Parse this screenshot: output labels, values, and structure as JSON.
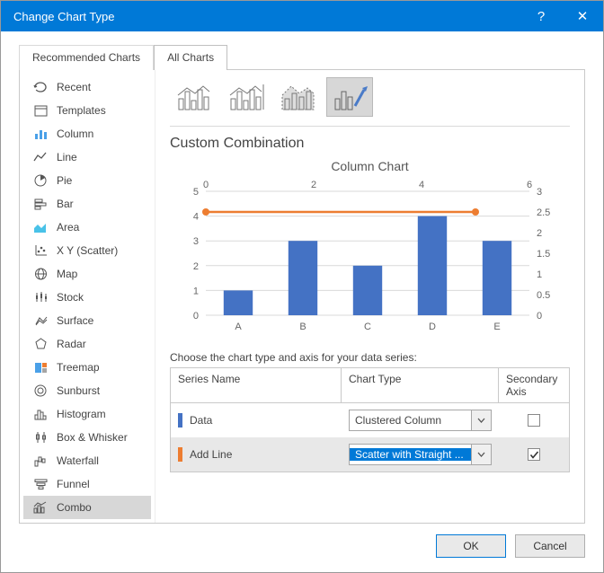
{
  "window": {
    "title": "Change Chart Type",
    "help_symbol": "?",
    "close_symbol": "✕"
  },
  "tabs": {
    "recommended": "Recommended Charts",
    "all": "All Charts"
  },
  "sidebar": {
    "items": [
      {
        "label": "Recent"
      },
      {
        "label": "Templates"
      },
      {
        "label": "Column"
      },
      {
        "label": "Line"
      },
      {
        "label": "Pie"
      },
      {
        "label": "Bar"
      },
      {
        "label": "Area"
      },
      {
        "label": "X Y (Scatter)"
      },
      {
        "label": "Map"
      },
      {
        "label": "Stock"
      },
      {
        "label": "Surface"
      },
      {
        "label": "Radar"
      },
      {
        "label": "Treemap"
      },
      {
        "label": "Sunburst"
      },
      {
        "label": "Histogram"
      },
      {
        "label": "Box & Whisker"
      },
      {
        "label": "Waterfall"
      },
      {
        "label": "Funnel"
      },
      {
        "label": "Combo"
      }
    ]
  },
  "main": {
    "section_title": "Custom Combination",
    "chart_title": "Column Chart",
    "series_instruction": "Choose the chart type and axis for your data series:",
    "table": {
      "headers": {
        "name": "Series Name",
        "type": "Chart Type",
        "axis": "Secondary Axis"
      },
      "rows": [
        {
          "swatch": "#4472c4",
          "name": "Data",
          "type": "Clustered Column",
          "secondary": false
        },
        {
          "swatch": "#ed7d31",
          "name": "Add Line",
          "type": "Scatter with Straight ...",
          "secondary": true
        }
      ]
    }
  },
  "footer": {
    "ok": "OK",
    "cancel": "Cancel"
  },
  "chart_data": {
    "type": "combo",
    "title": "Column Chart",
    "categories": [
      "A",
      "B",
      "C",
      "D",
      "E"
    ],
    "primary_axis": {
      "ylim": [
        0,
        5
      ],
      "ticks": [
        0,
        1,
        2,
        3,
        4,
        5
      ]
    },
    "secondary_axis": {
      "ylim": [
        0,
        3
      ],
      "ticks": [
        0,
        0.5,
        1,
        1.5,
        2,
        2.5,
        3
      ]
    },
    "top_axis": {
      "ticks": [
        0,
        2,
        4,
        6
      ]
    },
    "series": [
      {
        "name": "Data",
        "type": "bar",
        "axis": "primary",
        "color": "#4472c4",
        "values": [
          1,
          3,
          2,
          4,
          3
        ]
      },
      {
        "name": "Add Line",
        "type": "line",
        "axis": "secondary",
        "color": "#ed7d31",
        "y_value": 2.5,
        "x_range": [
          0,
          5
        ]
      }
    ]
  }
}
